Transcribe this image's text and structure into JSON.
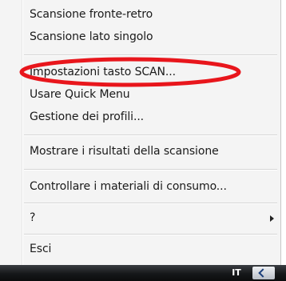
{
  "menu": {
    "items": [
      {
        "label": "Scansione fronte-retro"
      },
      {
        "label": "Scansione lato singolo"
      },
      {
        "label": "Impostazioni tasto SCAN..."
      },
      {
        "label": "Usare Quick Menu"
      },
      {
        "label": "Gestione dei profili..."
      },
      {
        "label": "Mostrare i risultati della scansione"
      },
      {
        "label": "Controllare i materiali di consumo..."
      },
      {
        "label": "?"
      },
      {
        "label": "Esci"
      }
    ]
  },
  "annotation": {
    "highlight_color": "#e8161c"
  },
  "taskbar": {
    "language": "IT"
  }
}
